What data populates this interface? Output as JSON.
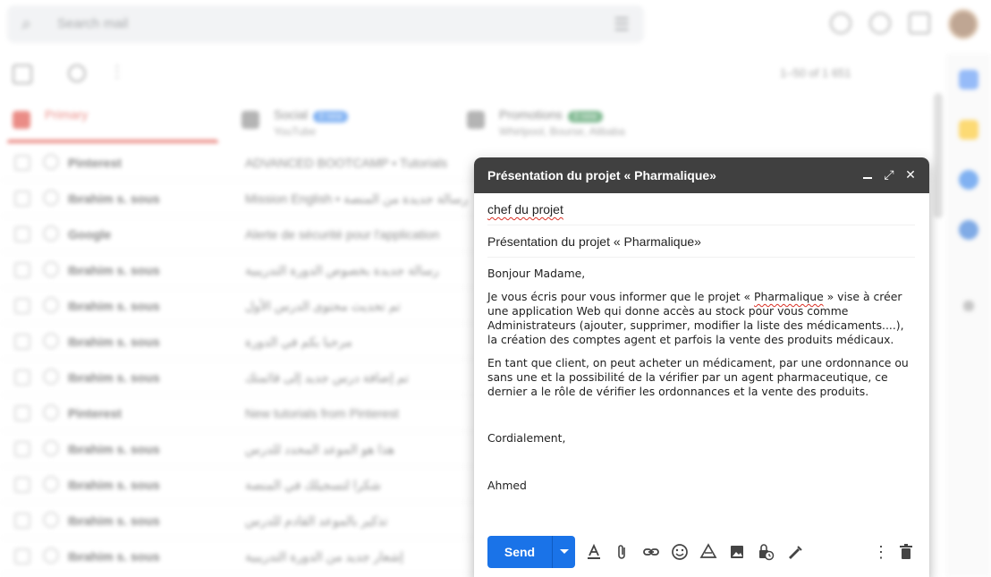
{
  "inbox": {
    "search_placeholder": "Search mail",
    "page_count": "1–50 of 1 651",
    "tabs": [
      {
        "label": "Primary",
        "sub": ""
      },
      {
        "label": "Social",
        "sub": "YouTube",
        "badge": "3 new"
      },
      {
        "label": "Promotions",
        "sub": "Whirlpool, Bourse, Alibaba",
        "badge": "3 new"
      }
    ],
    "rows": [
      {
        "sender": "Pinterest",
        "subject": "ADVANCED BOOTCAMP • Tutorials"
      },
      {
        "sender": "Ibrahim s. sous",
        "subject": "Mission English • رسالة جديدة من المنصة"
      },
      {
        "sender": "Google",
        "subject": "Alerte de sécurité pour l'application"
      },
      {
        "sender": "Ibrahim s. sous",
        "subject": "رسالة جديدة بخصوص الدورة التدريبية"
      },
      {
        "sender": "Ibrahim s. sous",
        "subject": "تم تحديث محتوى الدرس الأول"
      },
      {
        "sender": "Ibrahim s. sous",
        "subject": "مرحبا بكم في الدورة"
      },
      {
        "sender": "Ibrahim s. sous",
        "subject": "تم إضافة درس جديد إلى قائمتك"
      },
      {
        "sender": "Pinterest",
        "subject": "New tutorials from Pinterest"
      },
      {
        "sender": "Ibrahim s. sous",
        "subject": "هذا هو الموعد المحدد للدرس"
      },
      {
        "sender": "Ibrahim s. sous",
        "subject": "شكرا لتسجيلك في المنصة"
      },
      {
        "sender": "Ibrahim s. sous",
        "subject": "تذكير بالموعد القادم للدرس"
      },
      {
        "sender": "Ibrahim s. sous",
        "subject": "إشعار جديد من الدورة التدريبية"
      }
    ]
  },
  "compose": {
    "title": "Présentation du projet « Pharmalique»",
    "to": "chef du projet",
    "subject": "Présentation du projet « Pharmalique»",
    "greeting": "Bonjour Madame,",
    "para1_a": "Je vous écris pour vous informer que le projet « ",
    "para1_word": "Pharmalique",
    "para1_b": " » vise à créer une application Web qui donne accès au stock pour vous comme Administrateurs (ajouter, supprimer, modifier la liste des médicaments....), la création des comptes agent et parfois la vente des produits médicaux.",
    "para2": "En tant que client, on peut acheter un médicament, par une ordonnance ou sans une et la possibilité de la vérifier par un agent pharmaceutique, ce dernier a le rôle de vérifier les ordonnances et la vente des produits.",
    "closing": "Cordialement,",
    "signature": "Ahmed",
    "send_label": "Send"
  },
  "colors": {
    "header_bg": "#404040",
    "send_blue": "#1a73e8",
    "primary_red": "#d93025"
  },
  "icons": {
    "footer": [
      "format-text-icon",
      "attach-icon",
      "link-icon",
      "emoji-icon",
      "drive-icon",
      "image-icon",
      "confidential-icon",
      "signature-icon",
      "more-options-icon",
      "trash-icon"
    ]
  }
}
